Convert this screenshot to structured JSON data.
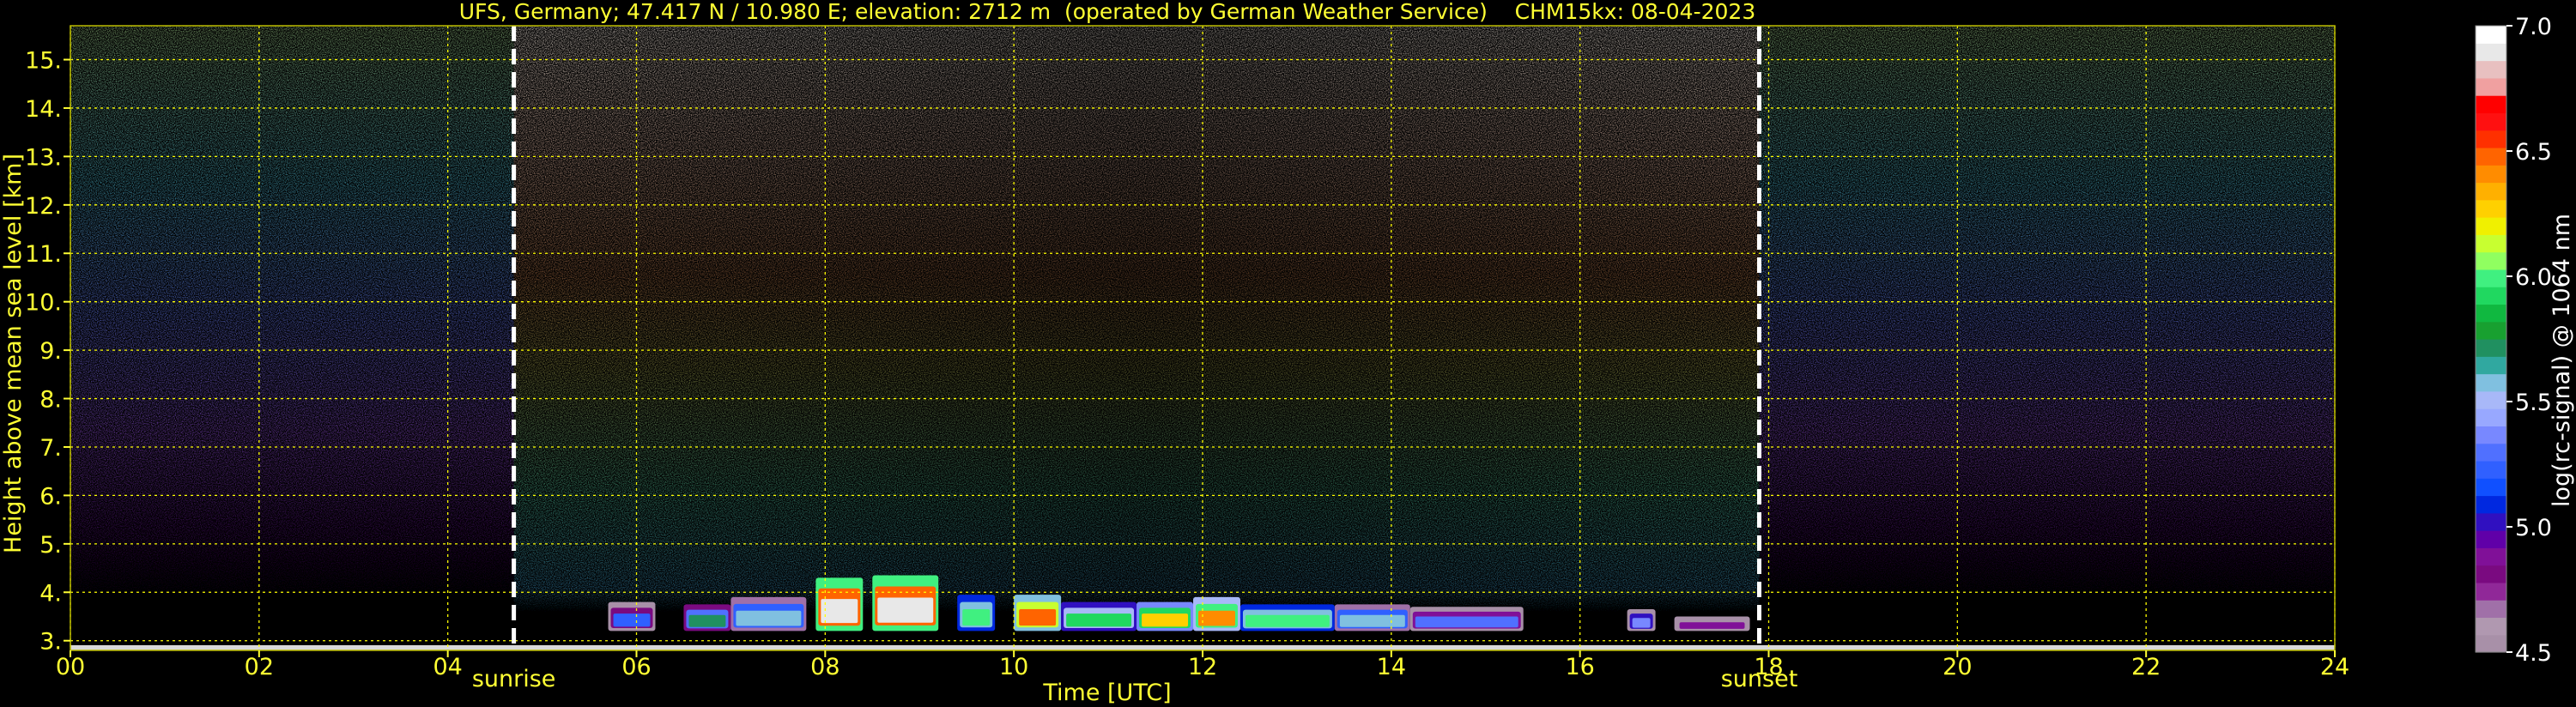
{
  "chart_data": {
    "type": "heatmap",
    "title": "UFS, Germany; 47.417 N / 10.980 E; elevation: 2712 m  (operated by German Weather Service)    CHM15kx: 08-04-2023",
    "xlabel": "Time [UTC]",
    "ylabel": "Height above mean sea level [km]",
    "xlim": [
      0,
      24
    ],
    "ylim": [
      2.8,
      15.7
    ],
    "xticks": [
      0,
      2,
      4,
      6,
      8,
      10,
      12,
      14,
      16,
      18,
      20,
      22,
      24
    ],
    "xticklabels": [
      "00",
      "02",
      "04",
      "06",
      "08",
      "10",
      "12",
      "14",
      "16",
      "18",
      "20",
      "22",
      "24"
    ],
    "yticks": [
      3,
      4,
      5,
      6,
      7,
      8,
      9,
      10,
      11,
      12,
      13,
      14,
      15
    ],
    "yticklabels": [
      "3.",
      "4.",
      "5.",
      "6.",
      "7.",
      "8.",
      "9.",
      "10.",
      "11.",
      "12.",
      "13.",
      "14.",
      "15."
    ],
    "grid": true,
    "grid_color": "#ffff00",
    "events": [
      {
        "label": "sunrise",
        "time": 4.7
      },
      {
        "label": "sunset",
        "time": 17.9
      }
    ],
    "colorbar": {
      "label": "log(rc-signal) @ 1064 nm",
      "range": [
        4.5,
        7.0
      ],
      "ticks": [
        4.5,
        5.0,
        5.5,
        6.0,
        6.5,
        7.0
      ],
      "ticklabels": [
        "4.5",
        "5.0",
        "5.5",
        "6.0",
        "6.5",
        "7.0"
      ],
      "colors": [
        "#a890a8",
        "#b098b0",
        "#a070a8",
        "#902898",
        "#7a0a80",
        "#801098",
        "#6000a8",
        "#3010c0",
        "#0028e0",
        "#1050ff",
        "#3060ff",
        "#5070ff",
        "#7888ff",
        "#98a8ff",
        "#a8b8f8",
        "#80c0e0",
        "#30a8a0",
        "#209060",
        "#18a030",
        "#10b840",
        "#20d860",
        "#40f080",
        "#90ff60",
        "#c8ff30",
        "#f0f000",
        "#ffd000",
        "#ffb000",
        "#ff8c00",
        "#ff6400",
        "#ff3000",
        "#ff1010",
        "#ff0000",
        "#f0a0a0",
        "#e8c0c0",
        "#e8e8e8",
        "#ffffff"
      ]
    },
    "clouds": [
      {
        "start": 5.7,
        "end": 6.2,
        "base": 3.2,
        "top": 3.8,
        "level": 5.2
      },
      {
        "start": 6.5,
        "end": 7.0,
        "base": 3.2,
        "top": 3.75,
        "level": 5.7
      },
      {
        "start": 7.0,
        "end": 7.8,
        "base": 3.2,
        "top": 3.9,
        "level": 5.6
      },
      {
        "start": 7.9,
        "end": 8.4,
        "base": 3.2,
        "top": 4.3,
        "level": 6.9
      },
      {
        "start": 8.5,
        "end": 9.2,
        "base": 3.2,
        "top": 4.35,
        "level": 6.9
      },
      {
        "start": 9.4,
        "end": 9.8,
        "base": 3.2,
        "top": 3.95,
        "level": 6.0
      },
      {
        "start": 10.0,
        "end": 10.5,
        "base": 3.2,
        "top": 3.95,
        "level": 6.5
      },
      {
        "start": 10.5,
        "end": 11.3,
        "base": 3.2,
        "top": 3.8,
        "level": 5.9
      },
      {
        "start": 11.3,
        "end": 11.9,
        "base": 3.2,
        "top": 3.8,
        "level": 6.3
      },
      {
        "start": 11.9,
        "end": 12.4,
        "base": 3.2,
        "top": 3.9,
        "level": 6.4
      },
      {
        "start": 12.4,
        "end": 13.4,
        "base": 3.2,
        "top": 3.75,
        "level": 6.0
      },
      {
        "start": 13.4,
        "end": 14.2,
        "base": 3.2,
        "top": 3.75,
        "level": 5.6
      },
      {
        "start": 14.2,
        "end": 15.4,
        "base": 3.2,
        "top": 3.7,
        "level": 5.3
      },
      {
        "start": 16.5,
        "end": 16.8,
        "base": 3.2,
        "top": 3.65,
        "level": 5.4
      },
      {
        "start": 17.0,
        "end": 17.8,
        "base": 3.2,
        "top": 3.5,
        "level": 4.9
      }
    ]
  }
}
